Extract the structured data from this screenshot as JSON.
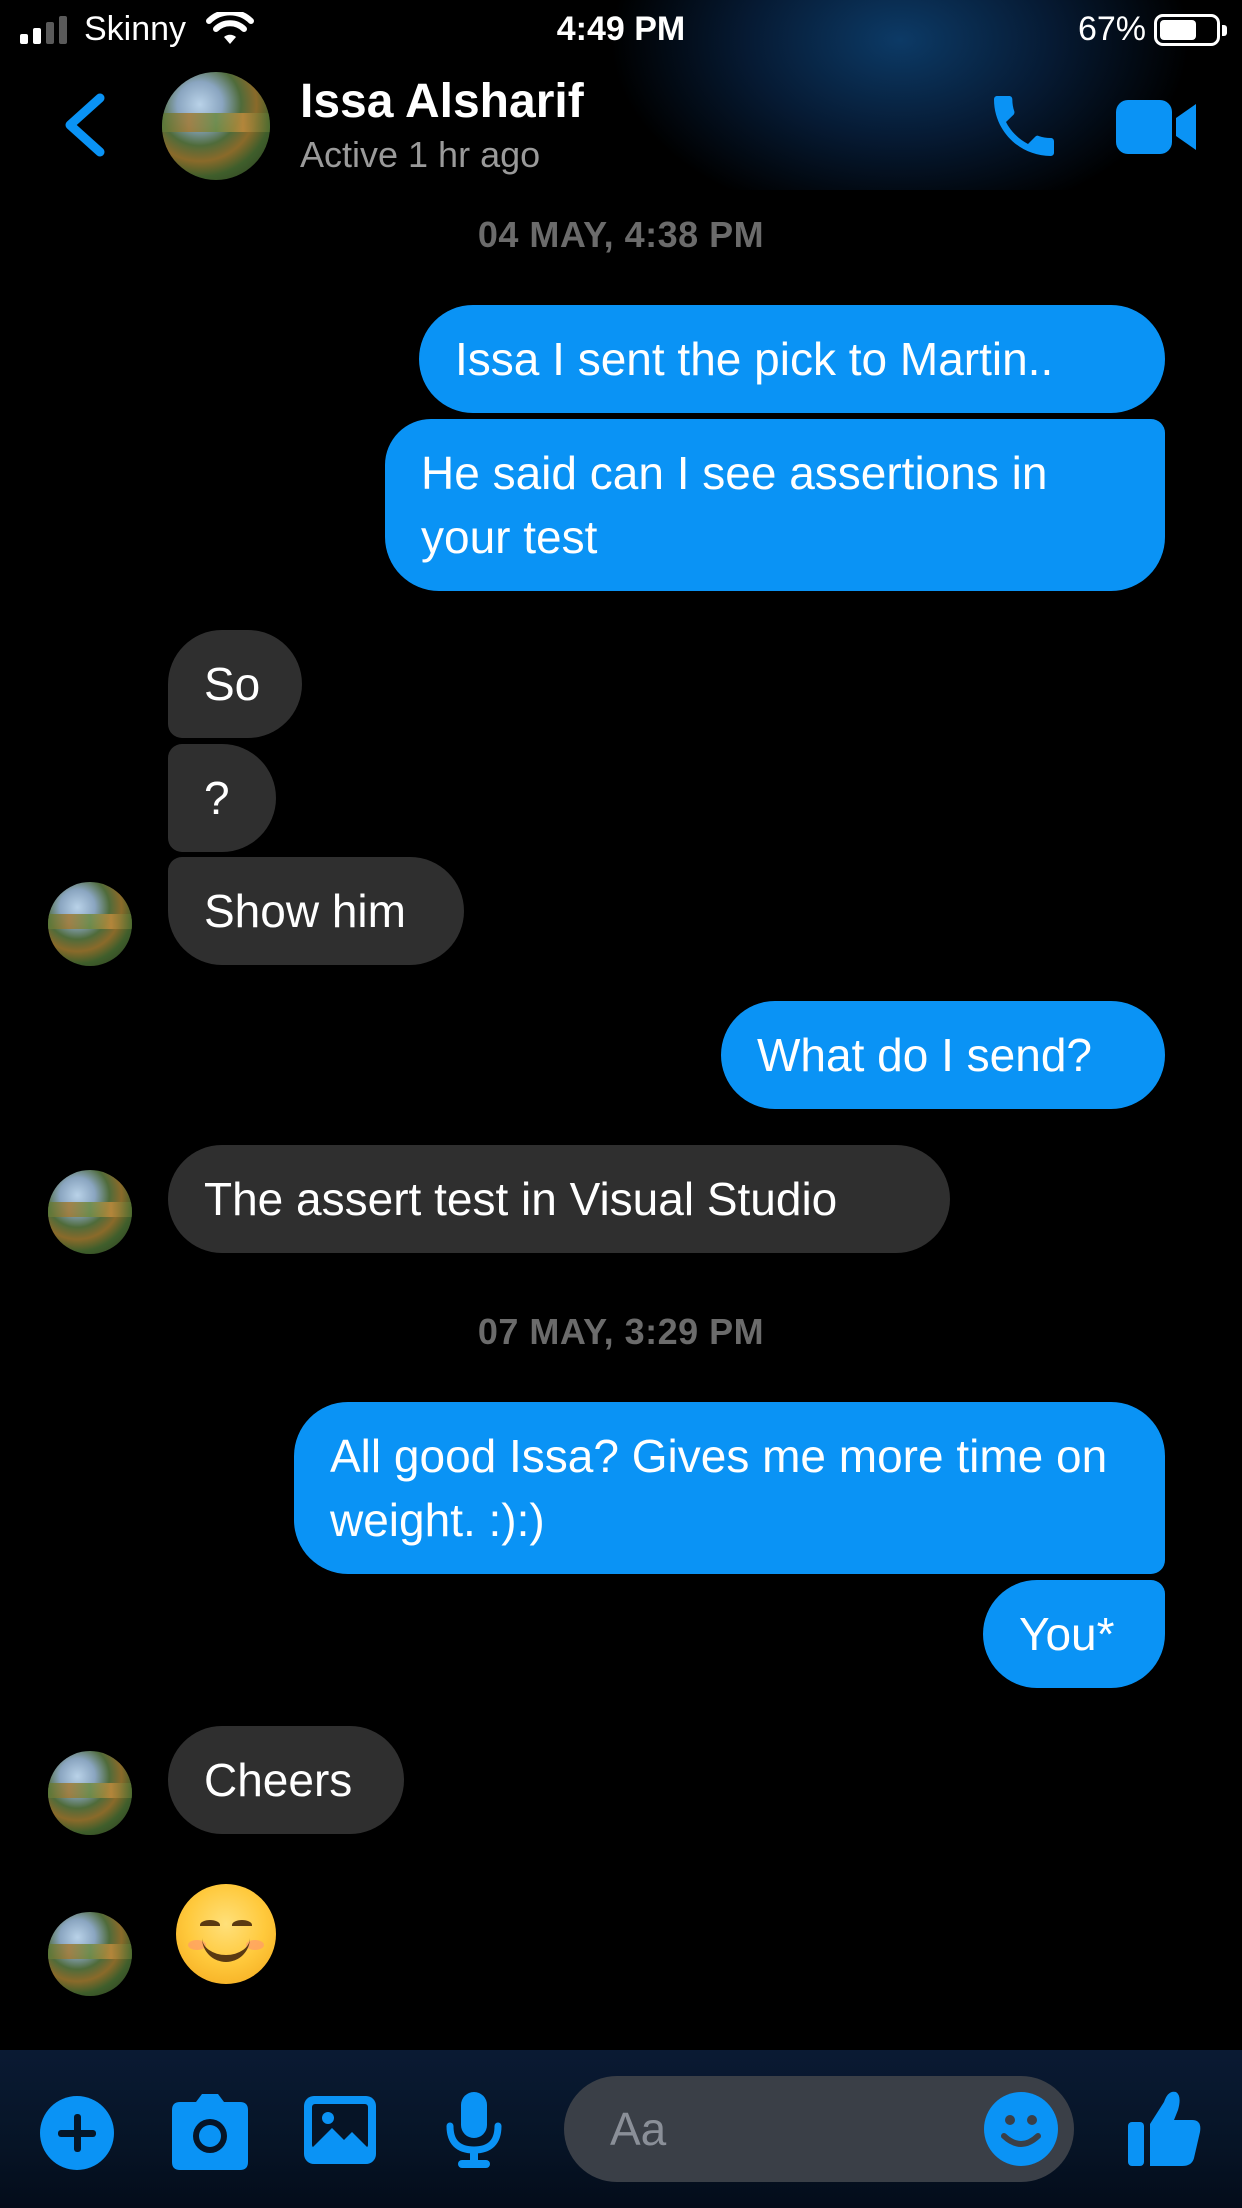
{
  "status_bar": {
    "carrier": "Skinny",
    "time": "4:49 PM",
    "battery_percent": "67%",
    "battery_level": 0.67,
    "signal_bars": 2
  },
  "header": {
    "back_icon": "chevron-left-icon",
    "contact_name": "Issa Alsharif",
    "contact_status": "Active 1 hr ago",
    "call_icon": "phone-icon",
    "video_icon": "video-camera-icon"
  },
  "conversation": [
    {
      "type": "timestamp",
      "text": "04 MAY, 4:38 PM"
    },
    {
      "type": "outgoing",
      "text": "Issa I sent the pick to Martin.."
    },
    {
      "type": "outgoing",
      "text": "He said can I see assertions in your test"
    },
    {
      "type": "incoming",
      "text": "So"
    },
    {
      "type": "incoming",
      "text": "?"
    },
    {
      "type": "incoming",
      "text": "Show him"
    },
    {
      "type": "outgoing",
      "text": "What do I send?"
    },
    {
      "type": "incoming",
      "text": "The assert test in Visual Studio"
    },
    {
      "type": "timestamp",
      "text": "07 MAY, 3:29 PM"
    },
    {
      "type": "outgoing",
      "text": "All good Issa? Gives me more time on weight. :):)"
    },
    {
      "type": "outgoing",
      "text": "You*"
    },
    {
      "type": "incoming",
      "text": "Cheers"
    },
    {
      "type": "incoming",
      "emoji": "smiling-face-emoji"
    }
  ],
  "composer": {
    "placeholder": "Aa",
    "icons": [
      "plus-icon",
      "camera-icon",
      "gallery-icon",
      "microphone-icon",
      "emoji-icon",
      "thumbs-up-icon"
    ]
  },
  "colors": {
    "accent": "#0a93f5",
    "incoming_bubble": "#2f2f2f",
    "background": "#000000",
    "timestamp": "#6b6b6b"
  }
}
